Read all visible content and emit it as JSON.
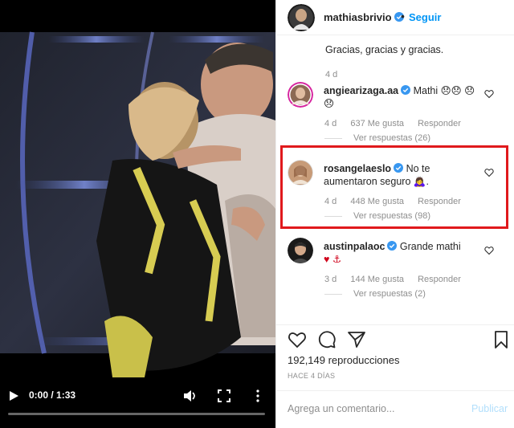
{
  "video": {
    "time": "0:00 / 1:33",
    "progress": 0,
    "controls": [
      "play-icon",
      "volume-icon",
      "fullscreen-icon",
      "more-vertical-icon"
    ]
  },
  "post": {
    "author": "mathiasbrivio",
    "follow_label": "Seguir",
    "separator": "•",
    "previous_caption": "Gracias, gracias y gracias.",
    "previous_date": "4 d",
    "views": "192,149 reproducciones",
    "posted_ago": "HACE 4 DÍAS"
  },
  "comments": [
    {
      "user": "angiearizaga.aa",
      "text": "Mathi 😞😞 😞😞",
      "time": "4 d",
      "likes": "637 Me gusta",
      "reply": "Responder",
      "replies": "Ver respuestas (26)"
    },
    {
      "user": "rosangelaeslo",
      "text": "No te aumentaron seguro 🙇‍♀️.",
      "time": "4 d",
      "likes": "448 Me gusta",
      "reply": "Responder",
      "replies": "Ver respuestas (98)"
    },
    {
      "user": "austinpalaoc",
      "text": "Grande mathi",
      "emoji": "♥ ⚓",
      "time": "3 d",
      "likes": "144 Me gusta",
      "reply": "Responder",
      "replies": "Ver respuestas (2)"
    }
  ],
  "composer": {
    "placeholder": "Agrega un comentario...",
    "publish_label": "Publicar"
  },
  "colors": {
    "link_blue": "#0095f6",
    "verified_blue": "#3897f0",
    "highlight_red": "#e0191c",
    "meta_gray": "#8e8e8e"
  }
}
